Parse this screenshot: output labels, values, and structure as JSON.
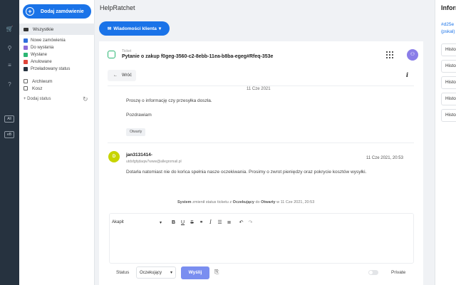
{
  "sidebar": {
    "add_order_label": "Dodaj zamówienie",
    "all_label": "Wszystkie",
    "statuses": [
      {
        "label": "Nowe zamówienia",
        "color": "#2f6fdc"
      },
      {
        "label": "Do wysłania",
        "color": "#8e6cd8"
      },
      {
        "label": "Wysłane",
        "color": "#2bb673"
      },
      {
        "label": "Anulowane",
        "color": "#e0453a"
      },
      {
        "label": "Przeładowany status",
        "color": "#26323f"
      }
    ],
    "archive_label": "Archiwum",
    "trash_label": "Kosz",
    "add_status_label": "+ Dodaj status"
  },
  "rail": {
    "badges": [
      "All",
      "eB"
    ]
  },
  "header": {
    "app_title": "HelpRatchet",
    "messages_button": "Wiadomości klienta"
  },
  "ticket": {
    "label": "Ticket",
    "title": "Pytanie o zakup f0geg-3560-c2-8ebb-11ea-b8ba-egeg#Rfeq-353e",
    "back_label": "Wróć"
  },
  "messages": [
    {
      "date": "11 Cze 2021",
      "text": "Proszę o informację czy przesyłka doszła.",
      "signature": "Pozdrawiam",
      "tag": "Otwarty"
    },
    {
      "avatar": "D",
      "sender": "jan3131414-",
      "email": "utdsfghjdaqw7www@allegromail.pl",
      "date": "11 Cze 2021, 20:53",
      "text": "Dotarła natomiast nie do końca spełnia nasze oczekiwania. Prosimy o zwrot pieniędzy oraz pokrycie kosztów wysyłki."
    }
  ],
  "system_event": {
    "actor": "System",
    "pre": "zmienił status ticketu z",
    "from": "Oczekujący",
    "mid": "do",
    "to": "Otwarty",
    "post": "w 11 Cze 2021, 20:53"
  },
  "editor": {
    "font_label": "Akapit",
    "status_label": "Status",
    "status_value": "Oczekujący",
    "send_label": "Wyślij",
    "private_label": "Private"
  },
  "right_panel": {
    "title": "Informacje",
    "link1": "#d25e",
    "link2": "(pskal)",
    "history_items": [
      "Historia",
      "Historia",
      "Historia",
      "Historia",
      "Historia"
    ]
  }
}
